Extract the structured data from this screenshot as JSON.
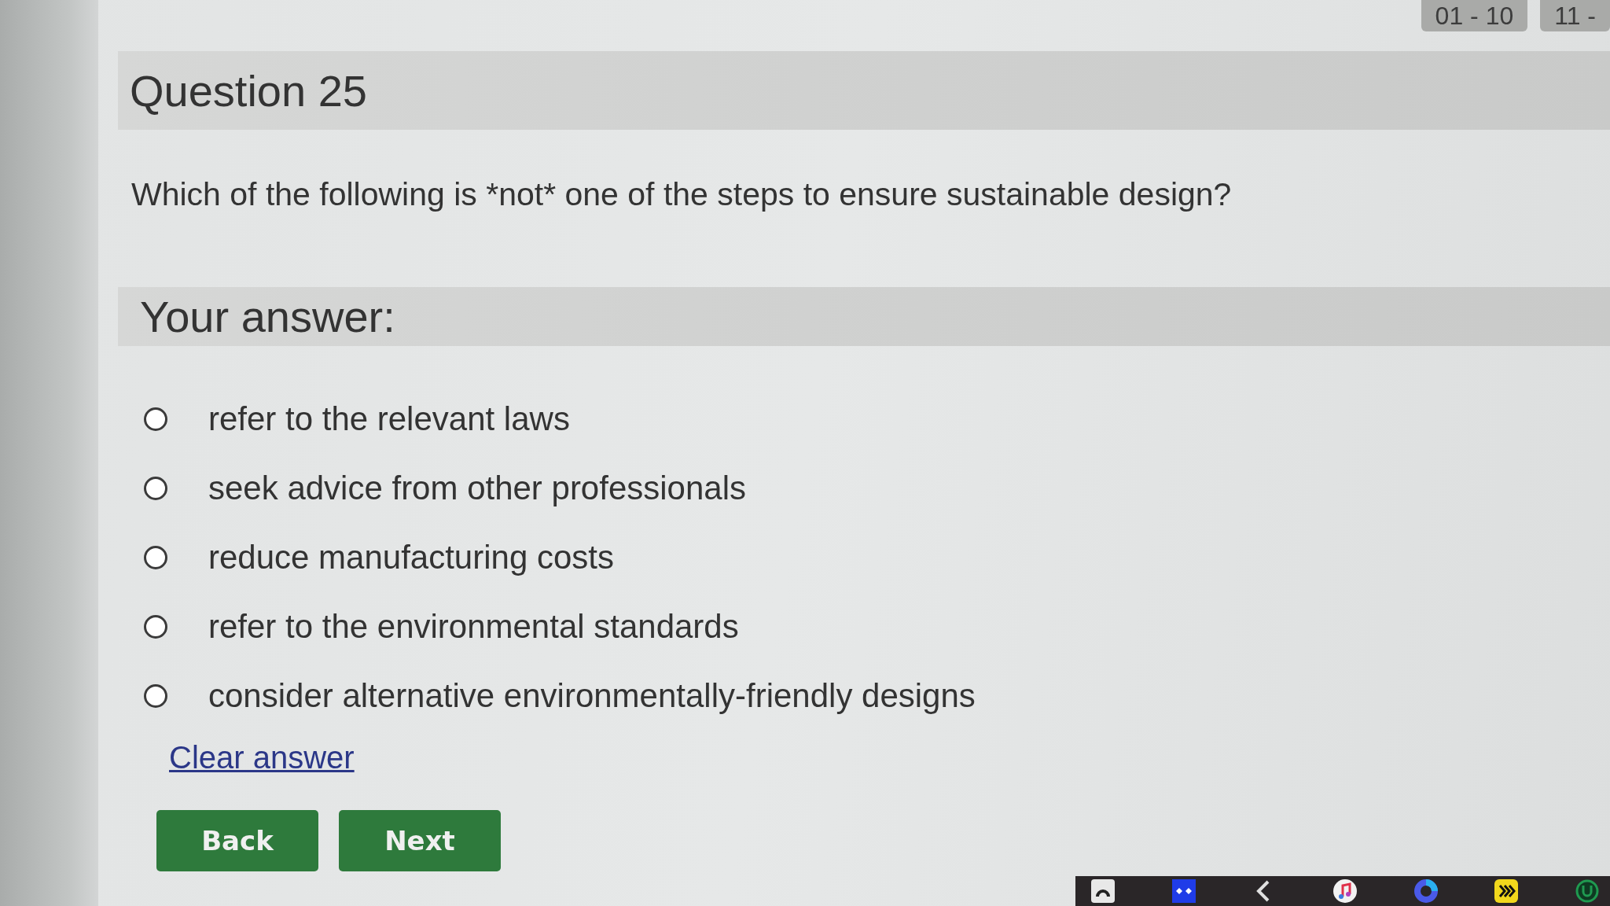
{
  "pagination": [
    {
      "label": "01 - 10",
      "selected": false
    },
    {
      "label": "11 -",
      "selected": false
    }
  ],
  "question": {
    "title": "Question 25",
    "text": "Which of the following is *not* one of the steps to ensure sustainable design?"
  },
  "answer": {
    "heading": "Your answer:",
    "options": [
      {
        "label": "refer to the relevant laws",
        "selected": false
      },
      {
        "label": "seek advice from other professionals",
        "selected": false
      },
      {
        "label": "reduce manufacturing costs",
        "selected": false
      },
      {
        "label": "refer to the environmental standards",
        "selected": false
      },
      {
        "label": "consider alternative environmentally-friendly designs",
        "selected": false
      }
    ],
    "clear_link": "Clear answer"
  },
  "buttons": [
    {
      "label": "Back"
    },
    {
      "label": "Next"
    }
  ]
}
